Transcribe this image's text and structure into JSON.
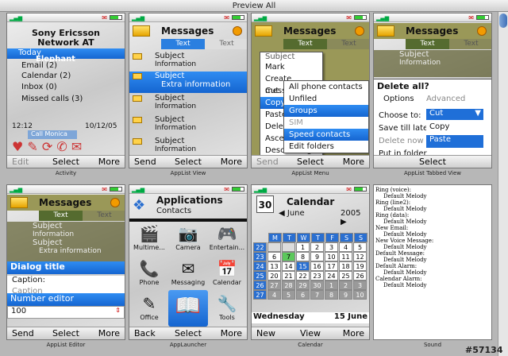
{
  "window": {
    "title": "Preview All"
  },
  "watermark": "#57134",
  "cells": {
    "activity": {
      "caption": "Activity",
      "operator": "Sony Ericsson",
      "network": "Network AT",
      "items": [
        "Today",
        "Email (2)",
        "Calendar (2)",
        "Inbox (0)",
        "Missed calls (3)"
      ],
      "overlay": "Elephant",
      "time": "12:12",
      "date": "10/12/05",
      "tooltip": "Call Monica",
      "soft": {
        "left": "Edit",
        "center": "Select",
        "right": "More"
      }
    },
    "applist_view": {
      "caption": "AppList View",
      "title": "Messages",
      "tabs": [
        "Text",
        "Text"
      ],
      "items": [
        {
          "subject": "Subject",
          "info": "Information"
        },
        {
          "subject": "Subject",
          "info": "Extra information"
        },
        {
          "subject": "Subject",
          "info": "Information"
        },
        {
          "subject": "Subject",
          "info": "Information"
        },
        {
          "subject": "Subject",
          "info": "Information"
        }
      ],
      "soft": {
        "left": "Send",
        "center": "Select",
        "right": "More"
      }
    },
    "applist_menu": {
      "caption": "AppList Menu",
      "title": "Messages",
      "tabs": [
        "Text",
        "Text"
      ],
      "behind": [
        "Subject",
        "Mark",
        "Create message",
        "Cut",
        "Copy",
        "Paste",
        "Delete",
        "Ascending",
        "Descending"
      ],
      "submenu": [
        "All phone contacts",
        "Unfiled",
        "Groups",
        "SIM",
        "Speed contacts",
        "Edit folders"
      ],
      "soft": {
        "left": "Send",
        "center": "Select",
        "right": "More"
      }
    },
    "applist_tabbed": {
      "caption": "AppList Tabbed View",
      "title": "Messages",
      "tabs": [
        "Text",
        "Text"
      ],
      "items": [
        {
          "subject": "Subject",
          "info": "Information"
        }
      ],
      "dialog_title": "Delete all?",
      "dialog_tabs": [
        "Options",
        "Advanced"
      ],
      "choose_label": "Choose to:",
      "choose_value": "Cut",
      "options": [
        "Save till late",
        "Delete now",
        "Put in folder"
      ],
      "dropdown": [
        "Copy",
        "Paste"
      ],
      "soft": {
        "left": "",
        "center": "Select",
        "right": ""
      }
    },
    "applist_editor": {
      "caption": "AppList Editor",
      "title": "Messages",
      "tabs": [
        "Text",
        "Text"
      ],
      "items": [
        {
          "subject": "Subject",
          "info": "Information"
        },
        {
          "subject": "Subject",
          "info": "Extra information"
        }
      ],
      "dialog_title": "Dialog title",
      "caption_label": "Caption:",
      "caption_label2": "Caption",
      "editor_title": "Number editor",
      "editor_value": "100",
      "soft": {
        "left": "Send",
        "center": "Select",
        "right": "More"
      }
    },
    "applauncher": {
      "caption": "AppLauncher",
      "title": "Applications",
      "subtitle": "Contacts",
      "tiles": [
        "Multime...",
        "Camera",
        "Entertain...",
        "Phone",
        "Messaging",
        "Calendar",
        "Office",
        "",
        "Tools"
      ],
      "soft": {
        "left": "Back",
        "center": "Select",
        "right": "More"
      }
    },
    "calendar": {
      "caption": "Calendar",
      "title": "Calendar",
      "badge": "30",
      "month": "June",
      "year": "2005",
      "days": [
        "M",
        "T",
        "W",
        "T",
        "F",
        "S",
        "S"
      ],
      "weeks": [
        [
          "22",
          "",
          "",
          "1",
          "2",
          "3",
          "4",
          "5"
        ],
        [
          "23",
          "6",
          "7",
          "8",
          "9",
          "10",
          "11",
          "12"
        ],
        [
          "24",
          "13",
          "14",
          "15",
          "16",
          "17",
          "18",
          "19"
        ],
        [
          "25",
          "20",
          "21",
          "22",
          "23",
          "24",
          "25",
          "26"
        ],
        [
          "26",
          "27",
          "28",
          "29",
          "30",
          "1",
          "2",
          "3"
        ],
        [
          "27",
          "4",
          "5",
          "6",
          "7",
          "8",
          "9",
          "10"
        ]
      ],
      "weekday": "Wednesday",
      "daydate": "15 June",
      "soft": {
        "left": "New",
        "center": "View",
        "right": "More"
      }
    },
    "sound": {
      "caption": "Sound",
      "lines": [
        [
          "Ring (voice):",
          "Default Melody"
        ],
        [
          "Ring (line2):",
          "Default Melody"
        ],
        [
          "Ring (data):",
          "Default Melody"
        ],
        [
          "New Email:",
          "Default Melody"
        ],
        [
          "New Voice Message:",
          "Default Melody"
        ],
        [
          "Default Message:",
          "Default Melody"
        ],
        [
          "Default Alarm:",
          "Default Melody"
        ],
        [
          "Calendar Alarm:",
          "Default Melody"
        ]
      ]
    }
  }
}
